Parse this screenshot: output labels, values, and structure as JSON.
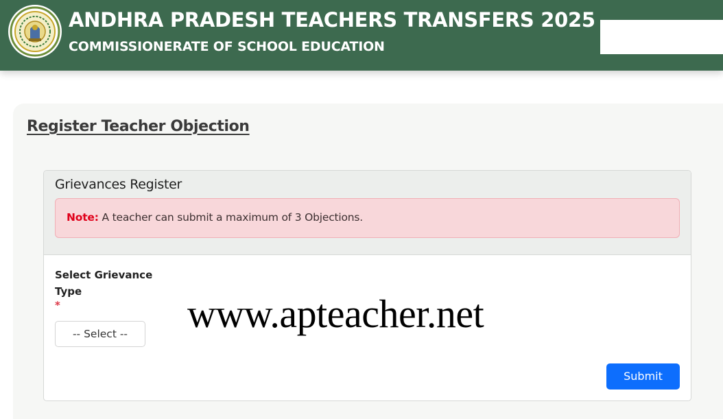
{
  "header": {
    "title": "ANDHRA PRADESH TEACHERS TRANSFERS 2025",
    "subtitle": "COMMISSIONERATE OF SCHOOL EDUCATION",
    "emblem_icon": "ap-state-emblem-icon",
    "colors": {
      "background": "#3d6a4f",
      "text": "#ffffff"
    }
  },
  "page": {
    "title": "Register Teacher Objection"
  },
  "panel": {
    "title": "Grievances Register",
    "alert": {
      "note_label": "Note:",
      "message": "A teacher can submit a maximum of 3 Objections.",
      "colors": {
        "background": "#f8d7da",
        "note": "#e0001a"
      }
    }
  },
  "form": {
    "grievance_type": {
      "label": "Select Grievance Type",
      "required_marker": "*",
      "selected_value": "-- Select --"
    },
    "submit_label": "Submit",
    "submit_color": "#0d6efd"
  },
  "watermark": "www.apteacher.net"
}
